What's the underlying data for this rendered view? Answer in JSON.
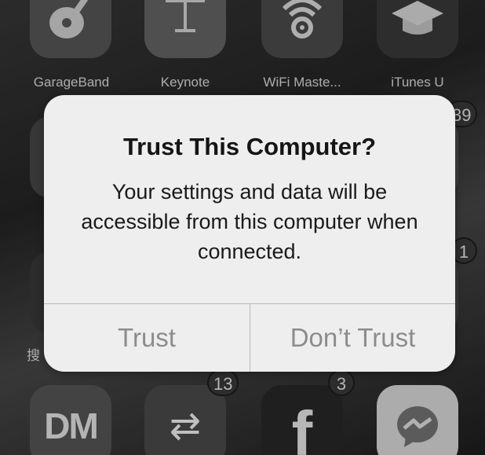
{
  "home_screen": {
    "top_row": [
      {
        "name": "GarageBand",
        "icon": "guitar-icon"
      },
      {
        "name": "Keynote",
        "icon": "podium-icon"
      },
      {
        "name": "WiFi Maste...",
        "icon": "wifi-key-icon"
      },
      {
        "name": "iTunes U",
        "icon": "graduation-cap-icon"
      }
    ],
    "partial_right_badge_1": "39",
    "partial_right_badge_2": "1",
    "partial_left_label": "搜",
    "bottom_row": [
      {
        "name": "DM",
        "icon": "dm-icon",
        "glyph": "DM"
      },
      {
        "name": "Transfer app",
        "icon": "transfer-icon",
        "glyph": "⇄",
        "badge": "13"
      },
      {
        "name": "Facebook",
        "icon": "facebook-icon",
        "glyph": "f",
        "badge": "3"
      },
      {
        "name": "Messenger",
        "icon": "messenger-icon"
      }
    ]
  },
  "alert": {
    "title": "Trust This Computer?",
    "message": "Your settings and data will be accessible from this computer when connected.",
    "buttons": {
      "trust": "Trust",
      "dont_trust": "Don’t Trust"
    }
  }
}
